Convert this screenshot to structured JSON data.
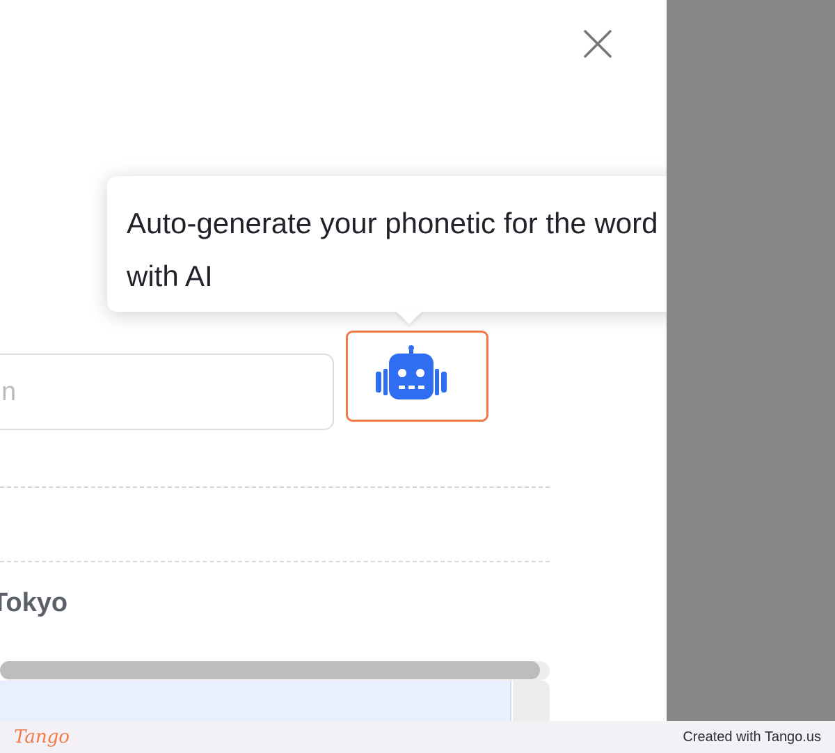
{
  "dialog": {
    "close_label": "Close"
  },
  "tooltip": {
    "text": "Auto-generate your phonetic for the word with AI"
  },
  "phonetic_input": {
    "value": "",
    "placeholder": "n"
  },
  "ai_button": {
    "icon": "robot-icon",
    "accent_color": "#f07a45",
    "icon_color": "#2f6df2"
  },
  "content": {
    "city_label": "Tokyo"
  },
  "footer": {
    "logo": "Tango",
    "credit": "Created with Tango.us"
  },
  "colors": {
    "overlay": "#878787",
    "highlight": "#f07a45",
    "robot": "#2f6df2"
  }
}
